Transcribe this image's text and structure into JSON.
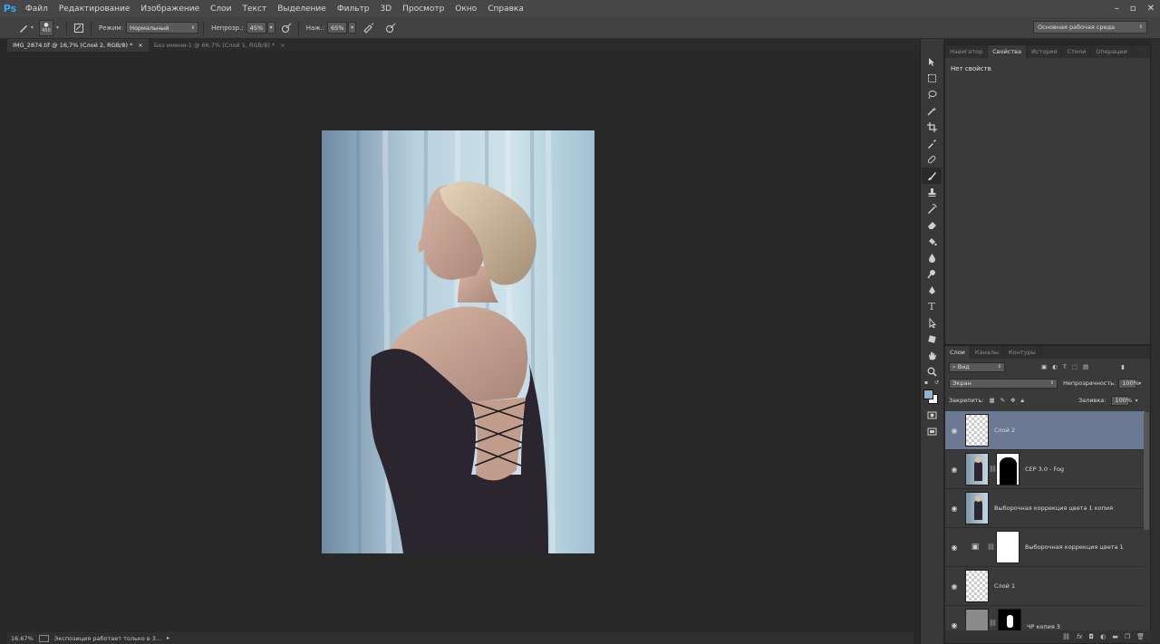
{
  "menubar": {
    "logo": "Ps",
    "items": [
      "Файл",
      "Редактирование",
      "Изображение",
      "Слои",
      "Текст",
      "Выделение",
      "Фильтр",
      "3D",
      "Просмотр",
      "Окно",
      "Справка"
    ],
    "controls": [
      "–",
      "▫",
      "✕"
    ]
  },
  "options": {
    "brush_size": "450",
    "mode_label": "Режим:",
    "mode_value": "Нормальный",
    "opacity_label": "Непрозр.:",
    "opacity_value": "45%",
    "flow_label": "Наж.:",
    "flow_value": "65%",
    "workspace": "Основная рабочая среда"
  },
  "tabs": [
    {
      "label": "IMG_2874.tif @ 16,7% (Слой 2, RGB/8) *",
      "close": "×"
    },
    {
      "label": "Без имени-1 @ 66,7% (Слой 1, RGB/8) *",
      "close": "×"
    }
  ],
  "status": {
    "zoom": "16.67%",
    "message": "Экспозиция работает только в 3..."
  },
  "top_panel": {
    "tabs": [
      "Навигатор",
      "Свойства",
      "История",
      "Стили",
      "Операции"
    ],
    "active_tab": "Свойства",
    "empty_text": "Нет свойств"
  },
  "layers_panel": {
    "tabs": [
      "Слои",
      "Каналы",
      "Контуры"
    ],
    "filter_kind": "Вид",
    "blend_mode": "Экран",
    "opacity_label": "Непрозрачность:",
    "opacity_value": "100%",
    "lock_label": "Закрепить:",
    "fill_label": "Заливка:",
    "fill_value": "100%",
    "layers": [
      {
        "name": "Слой 2",
        "selected": true
      },
      {
        "name": "CEP 3.0 - Fog",
        "selected": false
      },
      {
        "name": "Выборочная коррекция цвета 1 копия",
        "selected": false
      },
      {
        "name": "Выборочная коррекция цвета 1",
        "selected": false
      },
      {
        "name": "Слой 1",
        "selected": false
      },
      {
        "name": "ЧР копия 3",
        "selected": false
      }
    ],
    "bottom_icons": [
      "link-icon",
      "fx-icon",
      "mask-icon",
      "adjustment-icon",
      "group-icon",
      "new-layer-icon",
      "trash-icon"
    ]
  },
  "colors": {
    "ui_dark": "#282828",
    "panel": "#3a3a3a",
    "selected_layer": "#6b7a92",
    "foreground_swatch": "#8fb3c8",
    "background_swatch": "#ffffff"
  }
}
